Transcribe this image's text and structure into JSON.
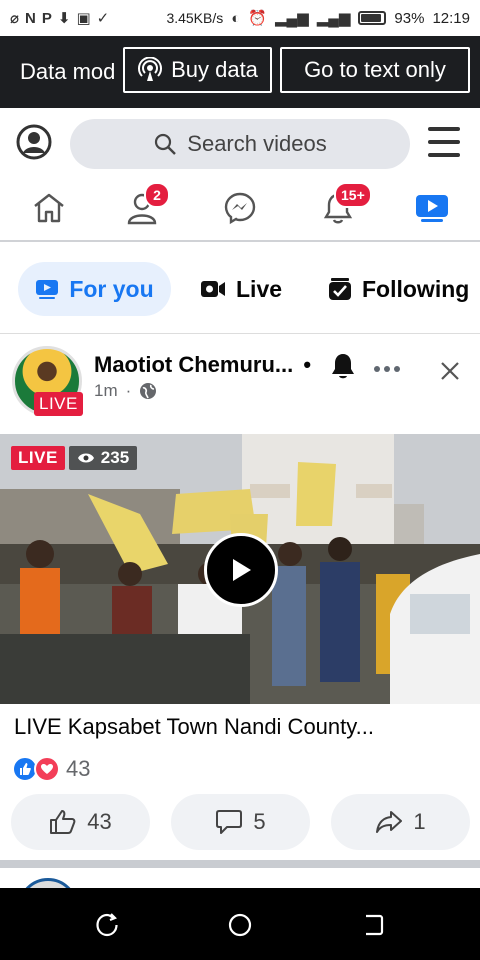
{
  "status_bar": {
    "speed": "3.45KB/s",
    "battery_percent": "93%",
    "battery_level": 0.93,
    "time": "12:19"
  },
  "data_banner": {
    "mode_label": "Data mod",
    "buy_data_label": "Buy data",
    "text_only_label": "Go to text only"
  },
  "search": {
    "placeholder": "Search videos"
  },
  "nav": {
    "friends_badge": "2",
    "notifications_badge": "15+"
  },
  "tabs": [
    {
      "label": "For you",
      "selected": true
    },
    {
      "label": "Live",
      "selected": false
    },
    {
      "label": "Following",
      "selected": false
    }
  ],
  "post": {
    "author": "Maotiot Chemuru...",
    "author_live_tag": "LIVE",
    "separator": "•",
    "time": "1m",
    "meta_separator": "·",
    "video_live_tag": "LIVE",
    "video_views": "235",
    "title": "LIVE Kapsabet Town Nandi County...",
    "reaction_count": "43",
    "like_count": "43",
    "comment_count": "5",
    "share_count": "1"
  },
  "colors": {
    "accent": "#1877f2",
    "badge": "#e41e3f",
    "banner_bg": "#1c1e21"
  }
}
